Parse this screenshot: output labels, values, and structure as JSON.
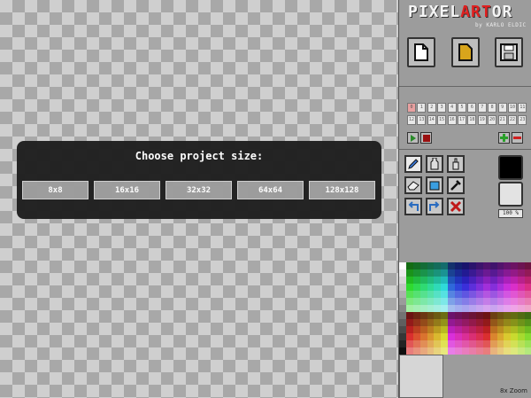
{
  "modal": {
    "title": "Choose project size:",
    "options": [
      "8x8",
      "16x16",
      "32x32",
      "64x64",
      "128x128"
    ]
  },
  "logo": {
    "prefix": "PIXEL",
    "highlight": "ART",
    "suffix": "OR",
    "byline": "by KARLO ELDIC"
  },
  "file_buttons": [
    {
      "name": "new-file-icon"
    },
    {
      "name": "open-file-icon"
    },
    {
      "name": "save-icon"
    }
  ],
  "frames": [
    "0",
    "1",
    "2",
    "3",
    "4",
    "5",
    "6",
    "7",
    "8",
    "9",
    "10",
    "11",
    "12",
    "13",
    "14",
    "15",
    "16",
    "17",
    "18",
    "19",
    "20",
    "21",
    "22",
    "23"
  ],
  "active_frame": 0,
  "tools": [
    {
      "name": "pencil-icon",
      "glyph": "✎"
    },
    {
      "name": "fill-bottle-icon",
      "glyph": "⛽"
    },
    {
      "name": "spray-bottle-icon",
      "glyph": "⌂"
    },
    {
      "name": "eraser-icon",
      "glyph": "▭"
    },
    {
      "name": "bucket-icon",
      "glyph": "⊔"
    },
    {
      "name": "eyedropper-icon",
      "glyph": "⟋"
    },
    {
      "name": "undo-icon",
      "glyph": "↰"
    },
    {
      "name": "redo-icon",
      "glyph": "↱"
    },
    {
      "name": "clear-icon",
      "glyph": "✕"
    }
  ],
  "zoom_percent": "100 %",
  "zoom_label": "8x Zoom",
  "colors": {
    "primary": "#000000",
    "secondary": "#e3e3e3",
    "logo_accent": "#e02020"
  }
}
